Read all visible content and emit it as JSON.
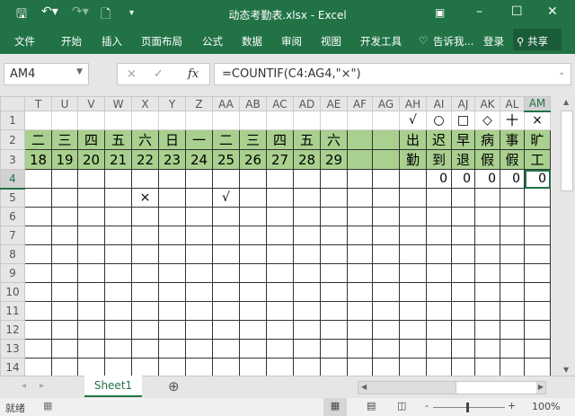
{
  "window": {
    "title": "动态考勤表.xlsx - Excel",
    "icons": [
      "save-icon",
      "undo-icon",
      "redo-icon",
      "new-file-icon",
      "customize-icon",
      "ribbon-display-icon",
      "minimize-icon",
      "maximize-icon",
      "close-icon"
    ]
  },
  "ribbon": {
    "tabs": [
      "文件",
      "开始",
      "插入",
      "页面布局",
      "公式",
      "数据",
      "审阅",
      "视图",
      "开发工具"
    ],
    "tell_me": "告诉我...",
    "login": "登录",
    "share": "共享"
  },
  "formula_bar": {
    "name_box": "AM4",
    "formula": "=COUNTIF(C4:AG4,\"×\")",
    "cancel": "×",
    "enter": "✓",
    "fx": "fx"
  },
  "columns": [
    "T",
    "U",
    "V",
    "W",
    "X",
    "Y",
    "Z",
    "AA",
    "AB",
    "AC",
    "AD",
    "AE",
    "AF",
    "AG",
    "AH",
    "AI",
    "AJ",
    "AK",
    "AL",
    "AM"
  ],
  "rows": [
    "1",
    "2",
    "3",
    "4",
    "5",
    "6",
    "7",
    "8",
    "9",
    "10",
    "11",
    "12",
    "13",
    "14"
  ],
  "weekdays": [
    "二",
    "三",
    "四",
    "五",
    "六",
    "日",
    "一",
    "二",
    "三",
    "四",
    "五",
    "六",
    "",
    ""
  ],
  "dates": [
    "18",
    "19",
    "20",
    "21",
    "22",
    "23",
    "24",
    "25",
    "26",
    "27",
    "28",
    "29",
    "",
    ""
  ],
  "summary_symbols": [
    "√",
    "○",
    "□",
    "◇",
    "十",
    "×"
  ],
  "summary_top": [
    "出",
    "迟",
    "早",
    "病",
    "事",
    "旷"
  ],
  "summary_bottom": [
    "勤",
    "到",
    "退",
    "假",
    "假",
    "工"
  ],
  "summary_counts": [
    "",
    "0",
    "0",
    "0",
    "0",
    "0"
  ],
  "row5": {
    "X": "×",
    "AA": "√"
  },
  "sheet_tabs": [
    "Sheet1"
  ],
  "status": {
    "ready": "就绪",
    "zoom": "100%"
  },
  "colors": {
    "accent": "#217346",
    "header_fill": "#a9d08e"
  }
}
